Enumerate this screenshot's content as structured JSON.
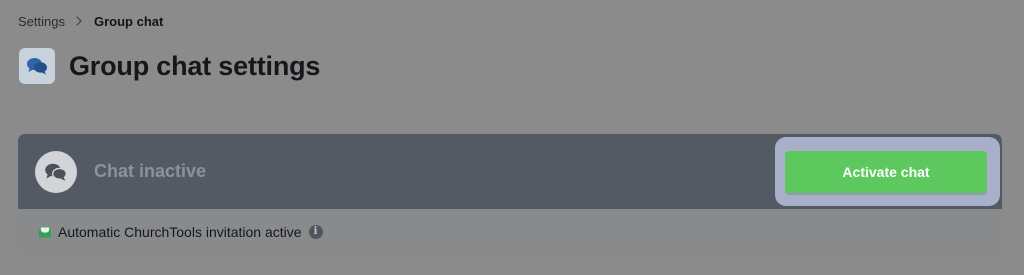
{
  "breadcrumb": {
    "parent": "Settings",
    "separator_icon": "chevron-right-icon",
    "current": "Group chat"
  },
  "page": {
    "title": "Group chat settings",
    "icon": "chat-bubbles-icon"
  },
  "chat_card": {
    "status": "Chat inactive",
    "status_icon": "chat-bubbles-icon",
    "activate_label": "Activate chat",
    "invitation_text": "Automatic ChurchTools invitation active",
    "invitation_icon": "envelope-icon",
    "info_icon": "info-icon"
  },
  "colors": {
    "overlay_background": "#8b8b8b",
    "card_header": "#545a64",
    "activate_button": "#5cc85e",
    "highlight_ring": "#a7b0c8",
    "envelope_green": "#3fb45a"
  }
}
